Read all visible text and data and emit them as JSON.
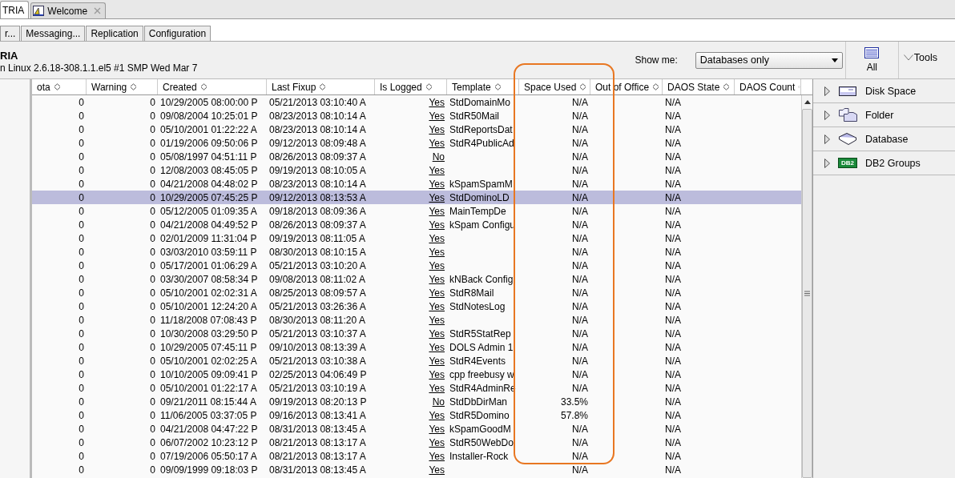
{
  "tabs": [
    {
      "label": "TRIA",
      "selected": true,
      "closable": false
    },
    {
      "label": "Welcome",
      "selected": false,
      "closable": true
    }
  ],
  "subtabs": [
    {
      "label": "r...",
      "selected": false
    },
    {
      "label": "Messaging...",
      "selected": false
    },
    {
      "label": "Replication",
      "selected": false
    },
    {
      "label": "Configuration",
      "selected": false
    }
  ],
  "server": {
    "name": "RIA",
    "description": "n Linux 2.6.18-308.1.1.el5 #1 SMP Wed Mar 7"
  },
  "show_me": {
    "label": "Show me:",
    "value": "Databases only"
  },
  "toolbar": {
    "all_label": "All",
    "tools_label": "Tools"
  },
  "table": {
    "columns": [
      "ota",
      "Warning",
      "Created",
      "Last Fixup",
      "Is Logged",
      "Template",
      "Space Used",
      "Out of Office",
      "DAOS State",
      "DAOS Count"
    ],
    "rows": [
      {
        "selected": false,
        "column_1": "0",
        "warning": "0",
        "created": "10/29/2005 08:00:00 P",
        "last_fixup": "05/21/2013 03:10:40 A",
        "is_logged": "Yes",
        "template": "StdDomainMo",
        "space_used": "N/A",
        "daos_state": "N/A"
      },
      {
        "selected": false,
        "column_1": "0",
        "warning": "0",
        "created": "09/08/2004 10:25:01 P",
        "last_fixup": "08/23/2013 08:10:14 A",
        "is_logged": "Yes",
        "template": "StdR50Mail",
        "space_used": "N/A",
        "daos_state": "N/A"
      },
      {
        "selected": false,
        "column_1": "0",
        "warning": "0",
        "created": "05/10/2001 01:22:22 A",
        "last_fixup": "08/23/2013 08:10:14 A",
        "is_logged": "Yes",
        "template": "StdReportsDat",
        "space_used": "N/A",
        "daos_state": "N/A"
      },
      {
        "selected": false,
        "column_1": "0",
        "warning": "0",
        "created": "01/19/2006 09:50:06 P",
        "last_fixup": "09/12/2013 08:09:48 A",
        "is_logged": "Yes",
        "template": "StdR4PublicAd",
        "space_used": "N/A",
        "daos_state": "N/A"
      },
      {
        "selected": false,
        "column_1": "0",
        "warning": "0",
        "created": "05/08/1997 04:51:11 P",
        "last_fixup": "08/26/2013 08:09:37 A",
        "is_logged": "No",
        "space_used": "N/A",
        "daos_state": "N/A"
      },
      {
        "selected": false,
        "column_1": "0",
        "warning": "0",
        "created": "12/08/2003 08:45:05 P",
        "last_fixup": "09/19/2013 08:10:05 A",
        "is_logged": "Yes",
        "space_used": "N/A",
        "daos_state": "N/A"
      },
      {
        "selected": false,
        "column_1": "0",
        "warning": "0",
        "created": "04/21/2008 04:48:02 P",
        "last_fixup": "08/23/2013 08:10:14 A",
        "is_logged": "Yes",
        "template": "kSpamSpamM",
        "space_used": "N/A",
        "daos_state": "N/A"
      },
      {
        "selected": true,
        "column_1": "0",
        "warning": "0",
        "created": "10/29/2005 07:45:25 P",
        "last_fixup": "09/12/2013 08:13:53 A",
        "is_logged": "Yes",
        "template": "StdDominoLD",
        "space_used": "N/A",
        "daos_state": "N/A"
      },
      {
        "selected": false,
        "column_1": "0",
        "warning": "0",
        "created": "05/12/2005 01:09:35 A",
        "last_fixup": "09/18/2013 08:09:36 A",
        "is_logged": "Yes",
        "template": "MainTempDe",
        "space_used": "N/A",
        "daos_state": "N/A"
      },
      {
        "selected": false,
        "column_1": "0",
        "warning": "0",
        "created": "04/21/2008 04:49:52 P",
        "last_fixup": "08/26/2013 08:09:37 A",
        "is_logged": "Yes",
        "template": "kSpam Configu",
        "space_used": "N/A",
        "daos_state": "N/A"
      },
      {
        "selected": false,
        "column_1": "0",
        "warning": "0",
        "created": "02/01/2009 11:31:04 P",
        "last_fixup": "09/19/2013 08:11:05 A",
        "is_logged": "Yes",
        "space_used": "N/A",
        "daos_state": "N/A"
      },
      {
        "selected": false,
        "column_1": "0",
        "warning": "0",
        "created": "03/03/2010 03:59:11 P",
        "last_fixup": "08/30/2013 08:10:15 A",
        "is_logged": "Yes",
        "space_used": "N/A",
        "daos_state": "N/A"
      },
      {
        "selected": false,
        "column_1": "0",
        "warning": "0",
        "created": "05/17/2001 01:06:29 A",
        "last_fixup": "05/21/2013 03:10:20 A",
        "is_logged": "Yes",
        "space_used": "N/A",
        "daos_state": "N/A"
      },
      {
        "selected": false,
        "column_1": "0",
        "warning": "0",
        "created": "03/30/2007 08:58:34 P",
        "last_fixup": "09/08/2013 08:11:02 A",
        "is_logged": "Yes",
        "template": "kNBack Config",
        "space_used": "N/A",
        "daos_state": "N/A"
      },
      {
        "selected": false,
        "column_1": "0",
        "warning": "0",
        "created": "05/10/2001 02:02:31 A",
        "last_fixup": "08/25/2013 08:09:57 A",
        "is_logged": "Yes",
        "template": "StdR8Mail",
        "space_used": "N/A",
        "daos_state": "N/A"
      },
      {
        "selected": false,
        "column_1": "0",
        "warning": "0",
        "created": "05/10/2001 12:24:20 A",
        "last_fixup": "05/21/2013 03:26:36 A",
        "is_logged": "Yes",
        "template": "StdNotesLog",
        "space_used": "N/A",
        "daos_state": "N/A"
      },
      {
        "selected": false,
        "column_1": "0",
        "warning": "0",
        "created": "11/18/2008 07:08:43 P",
        "last_fixup": "08/30/2013 08:11:20 A",
        "is_logged": "Yes",
        "space_used": "N/A",
        "daos_state": "N/A"
      },
      {
        "selected": false,
        "column_1": "0",
        "warning": "0",
        "created": "10/30/2008 03:29:50 P",
        "last_fixup": "05/21/2013 03:10:37 A",
        "is_logged": "Yes",
        "template": "StdR5StatRep",
        "space_used": "N/A",
        "daos_state": "N/A"
      },
      {
        "selected": false,
        "column_1": "0",
        "warning": "0",
        "created": "10/29/2005 07:45:11 P",
        "last_fixup": "09/10/2013 08:13:39 A",
        "is_logged": "Yes",
        "template": "DOLS Admin 1",
        "space_used": "N/A",
        "daos_state": "N/A"
      },
      {
        "selected": false,
        "column_1": "0",
        "warning": "0",
        "created": "05/10/2001 02:02:25 A",
        "last_fixup": "05/21/2013 03:10:38 A",
        "is_logged": "Yes",
        "template": "StdR4Events",
        "space_used": "N/A",
        "daos_state": "N/A"
      },
      {
        "selected": false,
        "column_1": "0",
        "warning": "0",
        "created": "10/10/2005 09:09:41 P",
        "last_fixup": "02/25/2013 04:06:49 P",
        "is_logged": "Yes",
        "template": "cpp freebusy w",
        "space_used": "N/A",
        "daos_state": "N/A"
      },
      {
        "selected": false,
        "column_1": "0",
        "warning": "0",
        "created": "05/10/2001 01:22:17 A",
        "last_fixup": "05/21/2013 03:10:19 A",
        "is_logged": "Yes",
        "template": "StdR4AdminRe",
        "space_used": "N/A",
        "daos_state": "N/A"
      },
      {
        "selected": false,
        "column_1": "0",
        "warning": "0",
        "created": "09/21/2011 08:15:44 A",
        "last_fixup": "09/19/2013 08:20:13 P",
        "is_logged": "No",
        "template": "StdDbDirMan",
        "space_used": "33.5%",
        "daos_state": "N/A"
      },
      {
        "selected": false,
        "column_1": "0",
        "warning": "0",
        "created": "11/06/2005 03:37:05 P",
        "last_fixup": "09/16/2013 08:13:41 A",
        "is_logged": "Yes",
        "template": "StdR5Domino",
        "space_used": "57.8%",
        "daos_state": "N/A"
      },
      {
        "selected": false,
        "column_1": "0",
        "warning": "0",
        "created": "04/21/2008 04:47:22 P",
        "last_fixup": "08/31/2013 08:13:45 A",
        "is_logged": "Yes",
        "template": "kSpamGoodM",
        "space_used": "N/A",
        "daos_state": "N/A"
      },
      {
        "selected": false,
        "column_1": "0",
        "warning": "0",
        "created": "06/07/2002 10:23:12 P",
        "last_fixup": "08/21/2013 08:13:17 A",
        "is_logged": "Yes",
        "template": "StdR50WebDo",
        "space_used": "N/A",
        "daos_state": "N/A"
      },
      {
        "selected": false,
        "column_1": "0",
        "warning": "0",
        "created": "07/19/2006 05:50:17 A",
        "last_fixup": "08/21/2013 08:13:17 A",
        "is_logged": "Yes",
        "template": "Installer-Rock",
        "space_used": "N/A",
        "daos_state": "N/A"
      },
      {
        "selected": false,
        "column_1": "0",
        "warning": "0",
        "created": "09/09/1999 09:18:03 P",
        "last_fixup": "08/31/2013 08:13:45 A",
        "is_logged": "Yes",
        "space_used": "N/A",
        "daos_state": "N/A"
      }
    ]
  },
  "tree": [
    {
      "label": "Disk Space",
      "expanded": false
    },
    {
      "label": "Folder",
      "expanded": false
    },
    {
      "label": "Database",
      "expanded": false
    },
    {
      "label": "DB2 Groups",
      "expanded": false,
      "icon_text": "DB2"
    }
  ]
}
